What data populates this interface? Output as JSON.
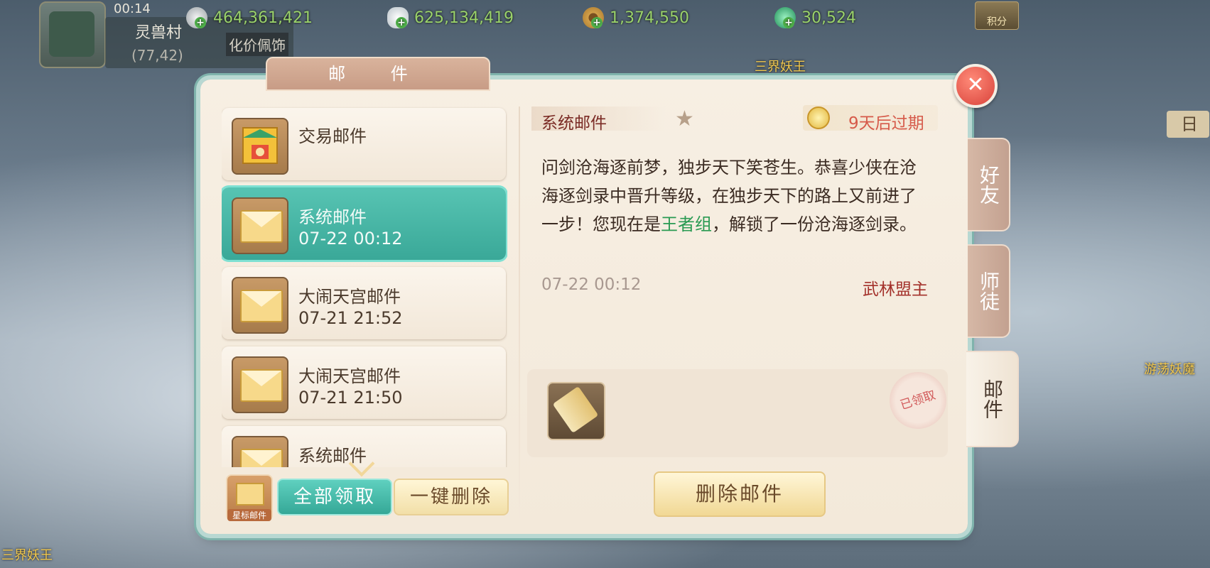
{
  "top_bar": {
    "time": "00:14",
    "location_name": "灵兽村",
    "location_coords": "(77,42)",
    "location_extra": "化价佩饰",
    "currencies": [
      {
        "icon": "silver-coin-icon",
        "value": "464,361,421",
        "color": "#9ad26a"
      },
      {
        "icon": "silver-ingot-icon",
        "value": "625,134,419",
        "color": "#9ad26a"
      },
      {
        "icon": "copper-coin-icon",
        "value": "1,374,550",
        "color": "#9ad26a"
      },
      {
        "icon": "jade-icon",
        "value": "30,524",
        "color": "#9ad26a"
      }
    ],
    "points_label": "积分"
  },
  "background_labels": {
    "top_center": "三界妖王",
    "bottom_left": "三界妖王",
    "right_mid": "游荡妖魔",
    "right_edge": "日"
  },
  "dialog": {
    "title": "邮 件",
    "close_label": "✕",
    "side_tabs": [
      "好友",
      "师徒",
      "邮件"
    ],
    "mail_list": [
      {
        "name": "交易邮件",
        "time": "",
        "icon": "trade-temple-icon"
      },
      {
        "name": "系统邮件",
        "time": "07-22 00:12",
        "icon": "envelope-icon"
      },
      {
        "name": "大闹天宫邮件",
        "time": "07-21 21:52",
        "icon": "envelope-icon"
      },
      {
        "name": "大闹天宫邮件",
        "time": "07-21 21:50",
        "icon": "envelope-icon"
      },
      {
        "name": "系统邮件",
        "time": "",
        "icon": "envelope-icon"
      }
    ],
    "star_mail_label": "星标邮件",
    "collect_all_label": "全部领取",
    "delete_all_label": "一键删除",
    "detail": {
      "title": "系统邮件",
      "expire": "9天后过期",
      "body_part1": "问剑沧海逐前梦，独步天下笑苍生。恭喜少侠在沧海逐剑录中晋升等级，在独步天下的路上又前进了一步！您现在是",
      "body_highlight": "王者组",
      "body_part2": "，解锁了一份沧海逐剑录。",
      "date": "07-22 00:12",
      "sender": "武林盟主",
      "claimed_stamp": "已领取",
      "delete_label": "删除邮件"
    }
  }
}
